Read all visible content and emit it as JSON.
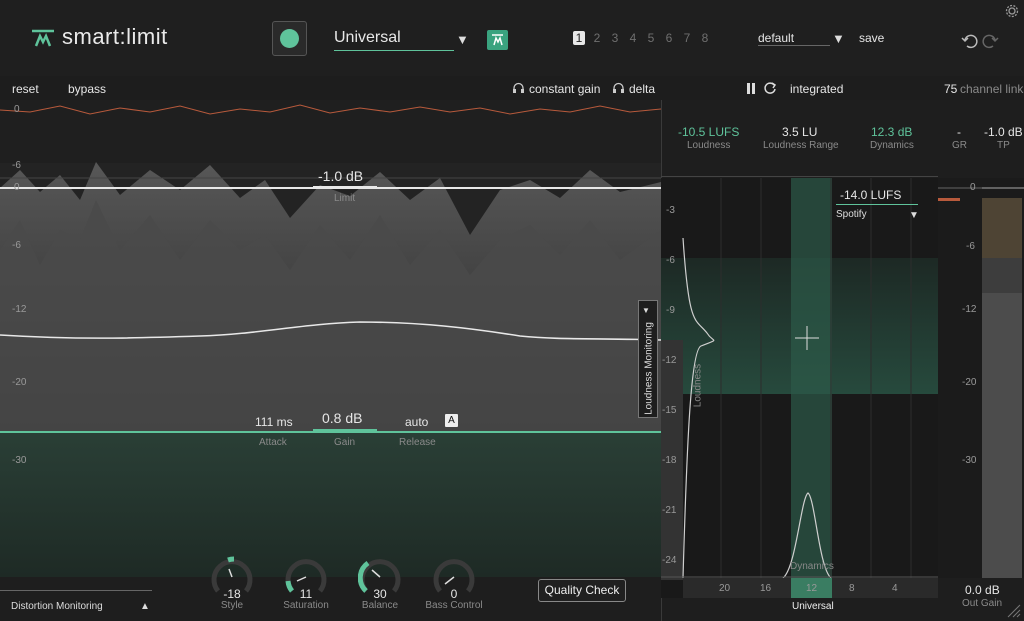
{
  "header": {
    "logo_text": "smart:limit",
    "profile": "Universal",
    "slots": [
      "1",
      "2",
      "3",
      "4",
      "5",
      "6",
      "7",
      "8"
    ],
    "active_slot": "1",
    "preset": "default",
    "save_label": "save"
  },
  "controls": {
    "reset": "reset",
    "bypass": "bypass",
    "constant_gain": "constant gain",
    "delta": "delta",
    "integrated": "integrated",
    "channel_link_value": "75",
    "channel_link_label": "channel link"
  },
  "main": {
    "limit_value": "-1.0 dB",
    "limit_label": "Limit",
    "attack_value": "111 ms",
    "attack_label": "Attack",
    "gain_value": "0.8 dB",
    "gain_label": "Gain",
    "release_value": "auto",
    "release_label": "Release",
    "release_badge": "A",
    "scale_top": [
      "0",
      "-6"
    ],
    "scale": [
      "0",
      "-6",
      "-12",
      "-20",
      "-30"
    ],
    "loudness_monitoring": "Loudness Monitoring"
  },
  "bottom": {
    "distortion_monitoring": "Distortion Monitoring",
    "knobs": [
      {
        "value": "-18",
        "label": "Style"
      },
      {
        "value": "11",
        "label": "Saturation"
      },
      {
        "value": "30",
        "label": "Balance"
      },
      {
        "value": "0",
        "label": "Bass Control"
      }
    ],
    "quality_check": "Quality Check"
  },
  "loudness": {
    "loudness_value": "-10.5 LUFS",
    "loudness_label": "Loudness",
    "range_value": "3.5 LU",
    "range_label": "Loudness Range",
    "dynamics_value": "12.3 dB",
    "dynamics_label": "Dynamics",
    "gr_value": "-",
    "gr_label": "GR",
    "tp_value": "-1.0 dB",
    "tp_label": "TP",
    "target_value": "-14.0 LUFS",
    "target_platform": "Spotify",
    "y_scale": [
      "-3",
      "-6",
      "-9",
      "-12",
      "-15",
      "-18",
      "-21",
      "-24"
    ],
    "x_scale": [
      "20",
      "16",
      "12",
      "8",
      "4"
    ],
    "vertical_label": "Loudness",
    "dynamics_axis_label": "Dynamics",
    "profile_tag": "Universal",
    "meter_scale": [
      "0",
      "-6",
      "-12",
      "-20",
      "-30"
    ],
    "out_gain_value": "0.0 dB",
    "out_gain_label": "Out Gain"
  },
  "colors": {
    "accent": "#5fc39b",
    "waveform": "#555555",
    "gr_line": "#b85a3c"
  }
}
